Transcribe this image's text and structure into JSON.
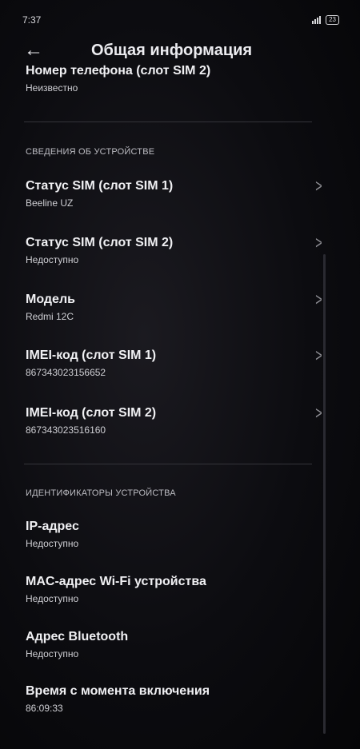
{
  "status": {
    "time": "7:37",
    "battery": "23"
  },
  "header": {
    "title": "Общая информация"
  },
  "top_item": {
    "title": "Номер телефона (слот SIM 2)",
    "sub": "Неизвестно"
  },
  "sections": {
    "device_info": "СВЕДЕНИЯ ОБ УСТРОЙСТВЕ",
    "device_ids": "ИДЕНТИФИКАТОРЫ УСТРОЙСТВА"
  },
  "items": [
    {
      "title": "Статус SIM (слот SIM 1)",
      "sub": "Beeline UZ"
    },
    {
      "title": "Статус SIM (слот SIM 2)",
      "sub": "Недоступно"
    },
    {
      "title": "Модель",
      "sub": "Redmi 12C"
    },
    {
      "title": "IMEI-код (слот SIM 1)",
      "sub": "867343023156652"
    },
    {
      "title": "IMEI-код (слот SIM 2)",
      "sub": "867343023516160"
    }
  ],
  "id_items": [
    {
      "title": "IP-адрес",
      "sub": "Недоступно"
    },
    {
      "title": "MAC-адрес Wi-Fi устройства",
      "sub": "Недоступно"
    },
    {
      "title": "Адрес Bluetooth",
      "sub": "Недоступно"
    },
    {
      "title": "Время с момента включения",
      "sub": "86:09:33"
    }
  ]
}
